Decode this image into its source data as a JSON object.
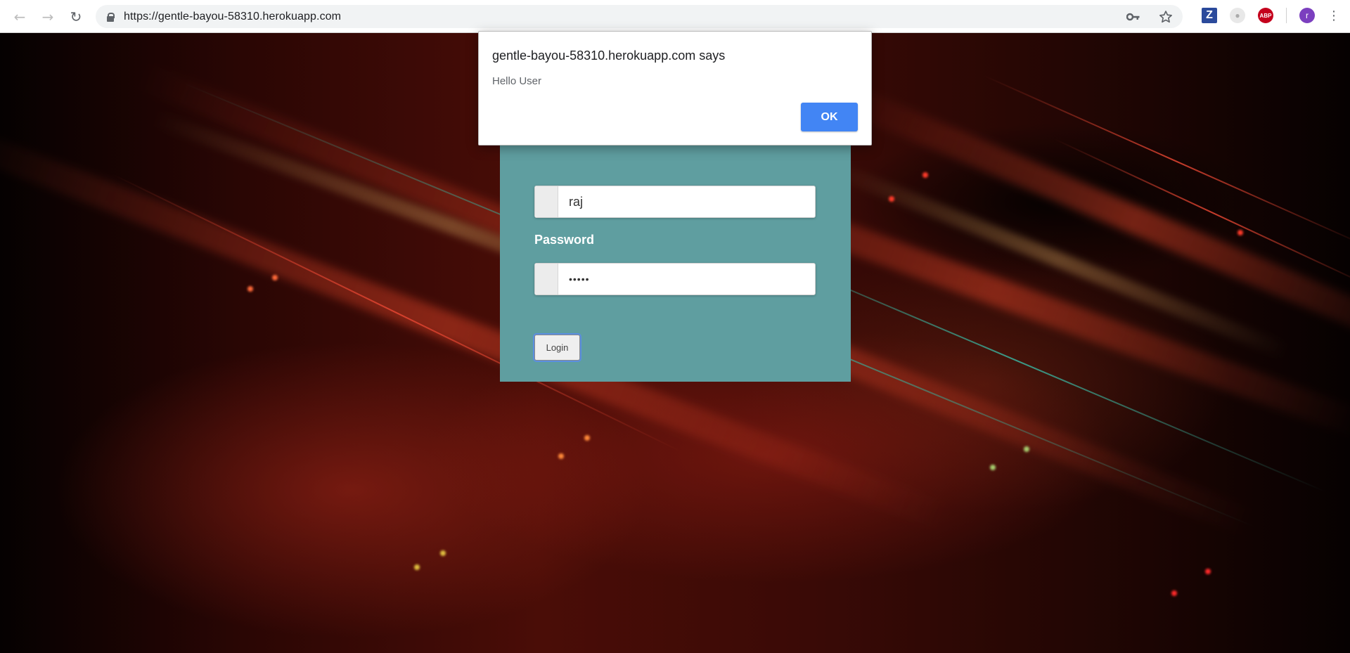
{
  "browser": {
    "url": "https://gentle-bayou-58310.herokuapp.com",
    "back_icon": "arrow-left-icon",
    "forward_icon": "arrow-right-icon",
    "reload_icon": "reload-icon",
    "avatar_letter": "r",
    "extensions": [
      {
        "name": "zotero-extension-icon",
        "glyph": "Z"
      },
      {
        "name": "ghost-extension-icon",
        "glyph": ""
      },
      {
        "name": "adblock-extension-icon",
        "glyph": "ABP"
      }
    ]
  },
  "login": {
    "username_value": "raj",
    "password_label": "Password",
    "password_value": "•••••",
    "login_button": "Login",
    "panel_color": "#5f9ea0"
  },
  "alert": {
    "title": "gentle-bayou-58310.herokuapp.com says",
    "message": "Hello User",
    "ok_label": "OK",
    "ok_color": "#4285f4"
  }
}
